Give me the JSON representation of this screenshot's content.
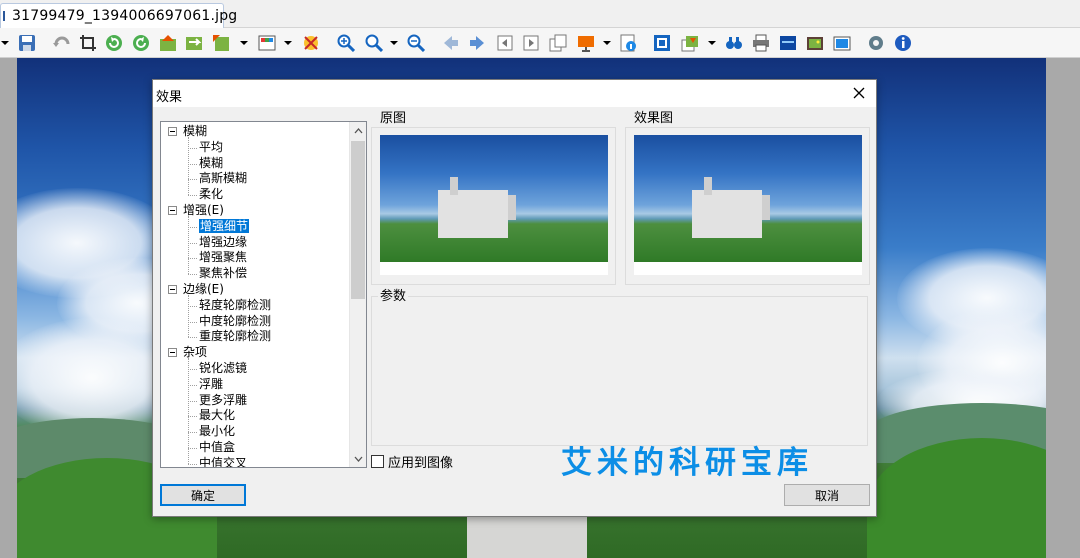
{
  "tab": {
    "filename": "31799479_1394006697061.jpg"
  },
  "toolbar_icons": [
    "dropdown-arrow",
    "save-icon",
    "undo-icon",
    "crop-icon",
    "rotate-left-icon",
    "rotate-right-icon",
    "move-up-icon",
    "move-image-icon",
    "transform-icon",
    "adjust-colors-icon",
    "effects-icon",
    "zoom-in-icon",
    "zoom-icon",
    "zoom-out-icon",
    "prev-icon",
    "next-icon",
    "first-page-icon",
    "page-icon",
    "copy-page-icon",
    "slideshow-icon",
    "info-file-icon",
    "fit-window-icon",
    "batch-icon",
    "find-icon",
    "print-icon",
    "scanner-icon",
    "thumbnails-icon",
    "screenshot-icon",
    "settings-icon",
    "about-icon"
  ],
  "dialog": {
    "title": "效果",
    "tree": [
      {
        "label": "模糊",
        "level": 0
      },
      {
        "label": "平均",
        "level": 1
      },
      {
        "label": "模糊",
        "level": 1
      },
      {
        "label": "高斯模糊",
        "level": 1
      },
      {
        "label": "柔化",
        "level": 1
      },
      {
        "label": "增强(E)",
        "level": 0
      },
      {
        "label": "增强细节",
        "level": 1,
        "selected": true
      },
      {
        "label": "增强边缘",
        "level": 1
      },
      {
        "label": "增强聚焦",
        "level": 1
      },
      {
        "label": "聚焦补偿",
        "level": 1
      },
      {
        "label": "边缘(E)",
        "level": 0
      },
      {
        "label": "轻度轮廓检测",
        "level": 1
      },
      {
        "label": "中度轮廓检测",
        "level": 1
      },
      {
        "label": "重度轮廓检测",
        "level": 1
      },
      {
        "label": "杂项",
        "level": 0
      },
      {
        "label": "锐化滤镜",
        "level": 1
      },
      {
        "label": "浮雕",
        "level": 1
      },
      {
        "label": "更多浮雕",
        "level": 1
      },
      {
        "label": "最大化",
        "level": 1
      },
      {
        "label": "最小化",
        "level": 1
      },
      {
        "label": "中值盒",
        "level": 1
      },
      {
        "label": "中值交叉",
        "level": 1
      }
    ],
    "original_label": "原图",
    "effect_label": "效果图",
    "params_label": "参数",
    "apply_label": "应用到图像",
    "apply_checked": false,
    "ok_label": "确定",
    "cancel_label": "取消"
  },
  "watermark": "艾米的科研宝库"
}
